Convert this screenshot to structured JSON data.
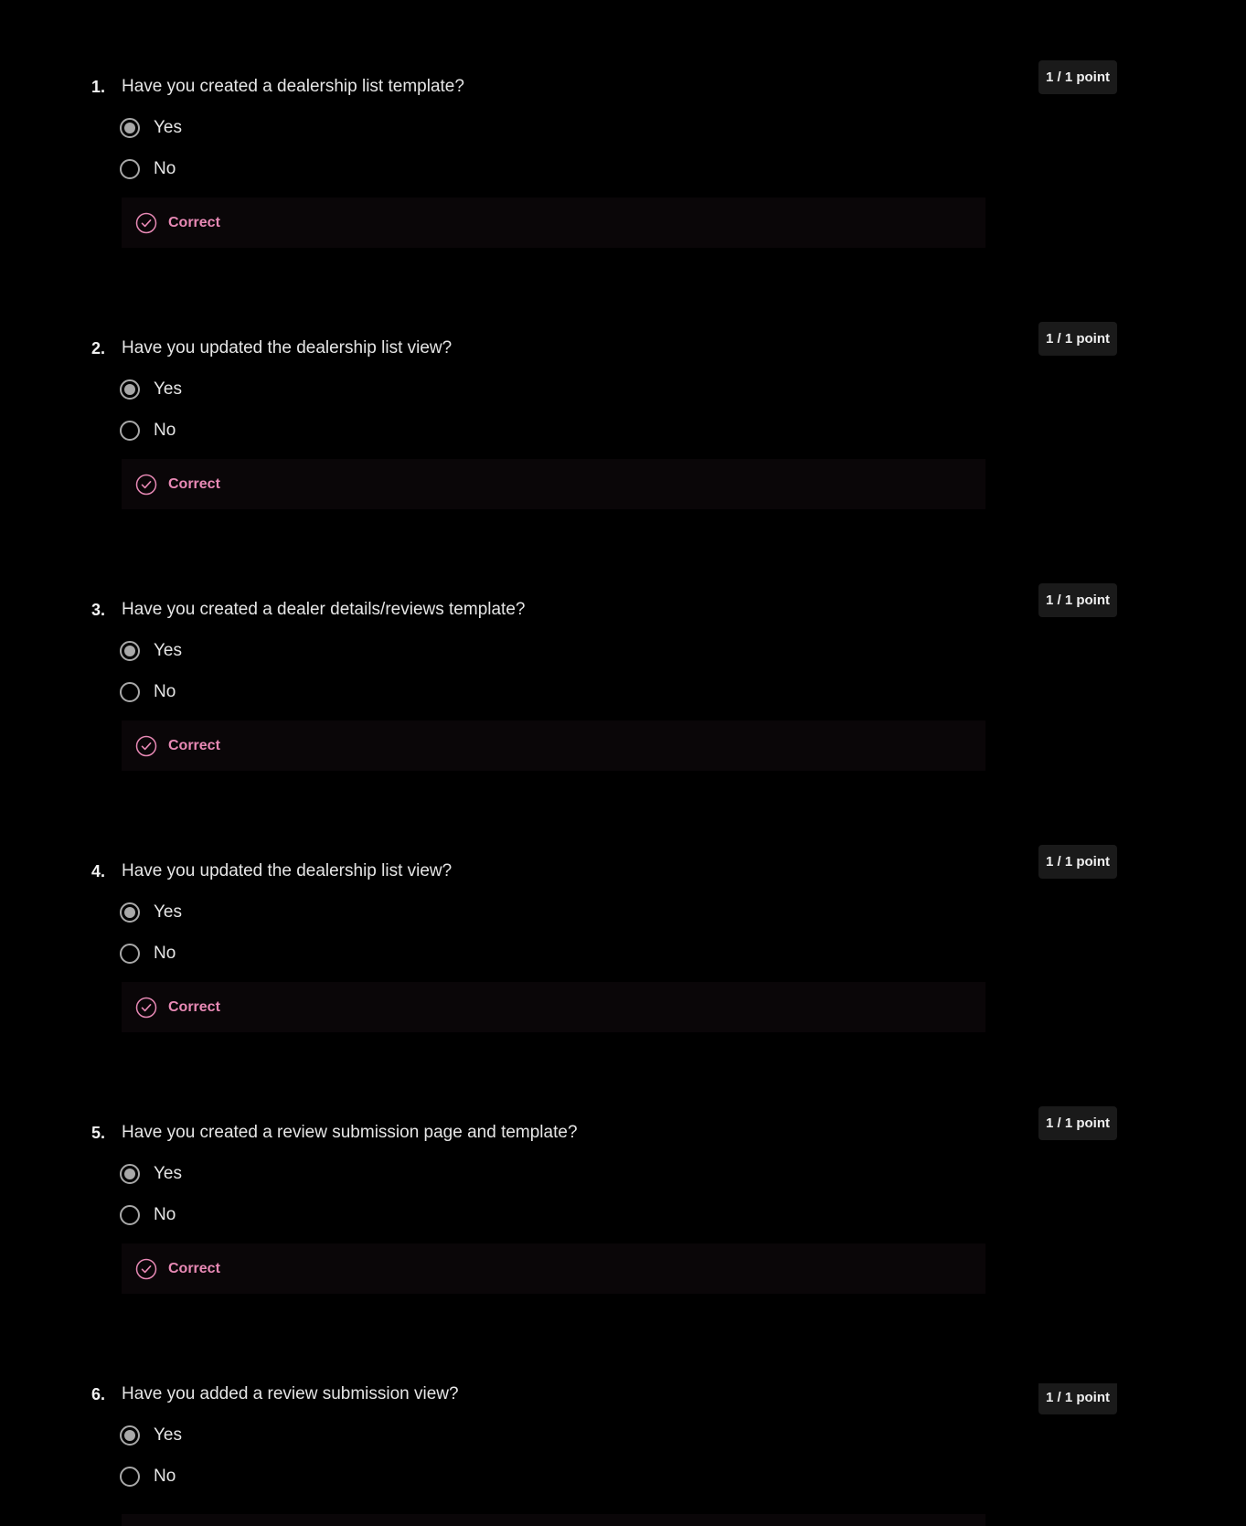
{
  "questions": [
    {
      "number": "1.",
      "text": "Have you created a dealership list template?",
      "points": "1 / 1 point",
      "options": [
        {
          "label": "Yes",
          "selected": true
        },
        {
          "label": "No",
          "selected": false
        }
      ],
      "feedback": "Correct"
    },
    {
      "number": "2.",
      "text": "Have you updated the dealership list view?",
      "points": "1 / 1 point",
      "options": [
        {
          "label": "Yes",
          "selected": true
        },
        {
          "label": "No",
          "selected": false
        }
      ],
      "feedback": "Correct"
    },
    {
      "number": "3.",
      "text": "Have you created a dealer details/reviews template?",
      "points": "1 / 1 point",
      "options": [
        {
          "label": "Yes",
          "selected": true
        },
        {
          "label": "No",
          "selected": false
        }
      ],
      "feedback": "Correct"
    },
    {
      "number": "4.",
      "text": "Have you updated the dealership list view?",
      "points": "1 / 1 point",
      "options": [
        {
          "label": "Yes",
          "selected": true
        },
        {
          "label": "No",
          "selected": false
        }
      ],
      "feedback": "Correct"
    },
    {
      "number": "5.",
      "text": "Have you created a review submission page and template?",
      "points": "1 / 1 point",
      "options": [
        {
          "label": "Yes",
          "selected": true
        },
        {
          "label": "No",
          "selected": false
        }
      ],
      "feedback": "Correct"
    },
    {
      "number": "6.",
      "text": "Have you added a review submission view?",
      "points": "1 / 1 point",
      "options": [
        {
          "label": "Yes",
          "selected": true
        },
        {
          "label": "No",
          "selected": false
        }
      ],
      "feedback": null
    }
  ],
  "icons": {
    "selected_radio": "radio-selected-icon",
    "unselected_radio": "radio-unselected-icon",
    "feedback": "check-circle-icon"
  },
  "colors": {
    "background": "#000000",
    "correct_accent": "#e889b5",
    "feedback_bg": "#0a0608",
    "badge_bg": "#1a1a1a"
  }
}
